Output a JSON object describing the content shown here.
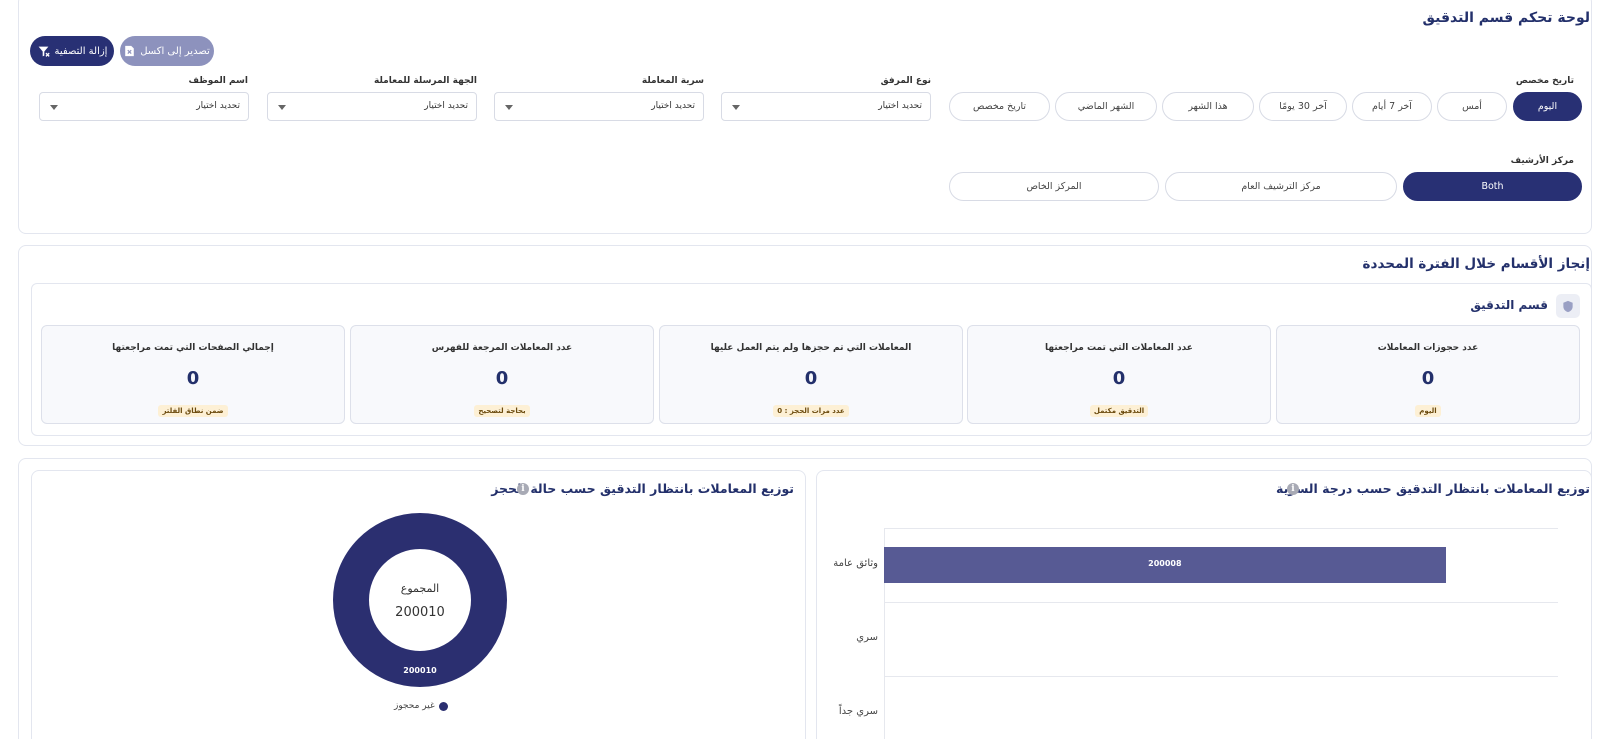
{
  "header": {
    "title": "لوحة تحكم قسم التدقيق",
    "clear_filter_label": "إزالة التصفية",
    "export_excel_label": "تصدير إلى اكسل"
  },
  "filters": {
    "custom_date_label": "تاريخ مخصص",
    "date_options": [
      "اليوم",
      "أمس",
      "آخر 7 أيام",
      "آخر 30 يومًا",
      "هذا الشهر",
      "الشهر الماضي",
      "تاريخ مخصص"
    ],
    "selected_date": "اليوم",
    "dropdowns": [
      {
        "label": "نوع المرفق",
        "value": "تحديد اختيار"
      },
      {
        "label": "سرية المعاملة",
        "value": "تحديد اختيار"
      },
      {
        "label": "الجهة المرسلة للمعاملة",
        "value": "تحديد اختيار"
      },
      {
        "label": "اسم الموظف",
        "value": "تحديد اختيار"
      }
    ],
    "archive_center_label": "مركز الأرشيف",
    "archive_options": [
      "Both",
      "مركز الترشيف العام",
      "المركز الخاص"
    ],
    "selected_archive": "Both"
  },
  "achievement": {
    "title": "إنجاز الأقسام خلال الفترة المحددة",
    "section_title": "قسم التدقيق",
    "cards": [
      {
        "title": "عدد حجوزات المعاملات",
        "value": "0",
        "badge": "اليوم"
      },
      {
        "title": "عدد المعاملات التي تمت مراجعتها",
        "value": "0",
        "badge": "التدقيق مكتمل"
      },
      {
        "title": "المعاملات التي تم حجزها ولم يتم العمل عليها",
        "value": "0",
        "badge": "عدد مرات الحجز : 0"
      },
      {
        "title": "عدد المعاملات المرجعة للفهرس",
        "value": "0",
        "badge": "بحاجة لتصحيح"
      },
      {
        "title": "إجمالي الصفحات التي تمت مراجعتها",
        "value": "0",
        "badge": "ضمن نطاق الفلتر"
      }
    ]
  },
  "charts": {
    "confidentiality_title": "توزيع المعاملات بانتظار التدقيق حسب درجة السرية",
    "booking_title": "توزيع المعاملات بانتظار التدقيق حسب حالة الحجز",
    "donut_total_label": "المجموع",
    "donut_total_value": "200010"
  },
  "chart_data": [
    {
      "type": "bar",
      "orientation": "horizontal",
      "categories": [
        "وثائق عامة",
        "سري",
        "سري جداً"
      ],
      "values": [
        200008,
        0,
        0
      ],
      "data_labels": [
        "200008",
        "",
        ""
      ],
      "color": "#4a4d8c",
      "title": "توزيع المعاملات بانتظار التدقيق حسب درجة السرية",
      "grid": true
    },
    {
      "type": "pie",
      "variant": "donut",
      "labels": [
        "غير محجوز"
      ],
      "values": [
        200010
      ],
      "data_labels": [
        "200010"
      ],
      "colors": [
        "#2b2f70"
      ],
      "center_text": [
        "المجموع",
        "200010"
      ],
      "legend": "bottom",
      "title": "توزيع المعاملات بانتظار التدقيق حسب حالة الحجز"
    }
  ]
}
